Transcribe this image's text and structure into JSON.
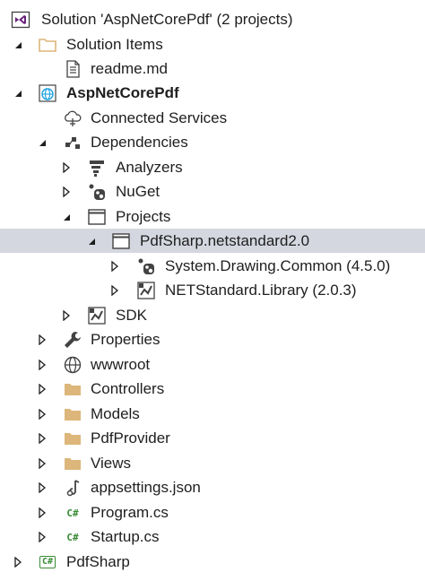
{
  "solution_explorer": {
    "solution": {
      "label": "Solution 'AspNetCorePdf' (2 projects)",
      "icon": "visual-studio-solution-icon"
    },
    "solution_items": {
      "label": "Solution Items",
      "icon": "folder-icon"
    },
    "readme": {
      "label": "readme.md",
      "icon": "document-icon"
    },
    "project_main": {
      "label": "AspNetCorePdf",
      "icon": "web-project-globe-icon"
    },
    "connected_services": {
      "label": "Connected Services",
      "icon": "cloud-connect-icon"
    },
    "dependencies": {
      "label": "Dependencies",
      "icon": "dependencies-icon"
    },
    "analyzers": {
      "label": "Analyzers",
      "icon": "analyzers-icon"
    },
    "nuget": {
      "label": "NuGet",
      "icon": "nuget-icon"
    },
    "projects": {
      "label": "Projects",
      "icon": "project-window-icon"
    },
    "pdfsharp_ref": {
      "label": "PdfSharp.netstandard2.0",
      "icon": "project-window-icon"
    },
    "system_drawing": {
      "label": "System.Drawing.Common (4.5.0)",
      "icon": "nuget-package-icon"
    },
    "netstandard": {
      "label": "NETStandard.Library (2.0.3)",
      "icon": "sdk-package-icon"
    },
    "sdk": {
      "label": "SDK",
      "icon": "sdk-icon"
    },
    "properties": {
      "label": "Properties",
      "icon": "wrench-icon"
    },
    "wwwroot": {
      "label": "wwwroot",
      "icon": "globe-icon"
    },
    "controllers": {
      "label": "Controllers",
      "icon": "folder-icon"
    },
    "models": {
      "label": "Models",
      "icon": "folder-icon"
    },
    "pdfprovider": {
      "label": "PdfProvider",
      "icon": "folder-icon"
    },
    "views": {
      "label": "Views",
      "icon": "folder-icon"
    },
    "appsettings": {
      "label": "appsettings.json",
      "icon": "json-file-icon"
    },
    "program": {
      "label": "Program.cs",
      "icon": "csharp-file-icon",
      "glyph": "C#"
    },
    "startup": {
      "label": "Startup.cs",
      "icon": "csharp-file-icon",
      "glyph": "C#"
    },
    "project_pdfsharp": {
      "label": "PdfSharp",
      "icon": "csharp-project-icon",
      "glyph": "C#"
    }
  },
  "colors": {
    "selection": "#d5d7e0",
    "folder": "#dcb67a",
    "csharp": "#388a34",
    "vs_purple": "#68217a",
    "text": "#1e1e1e"
  }
}
